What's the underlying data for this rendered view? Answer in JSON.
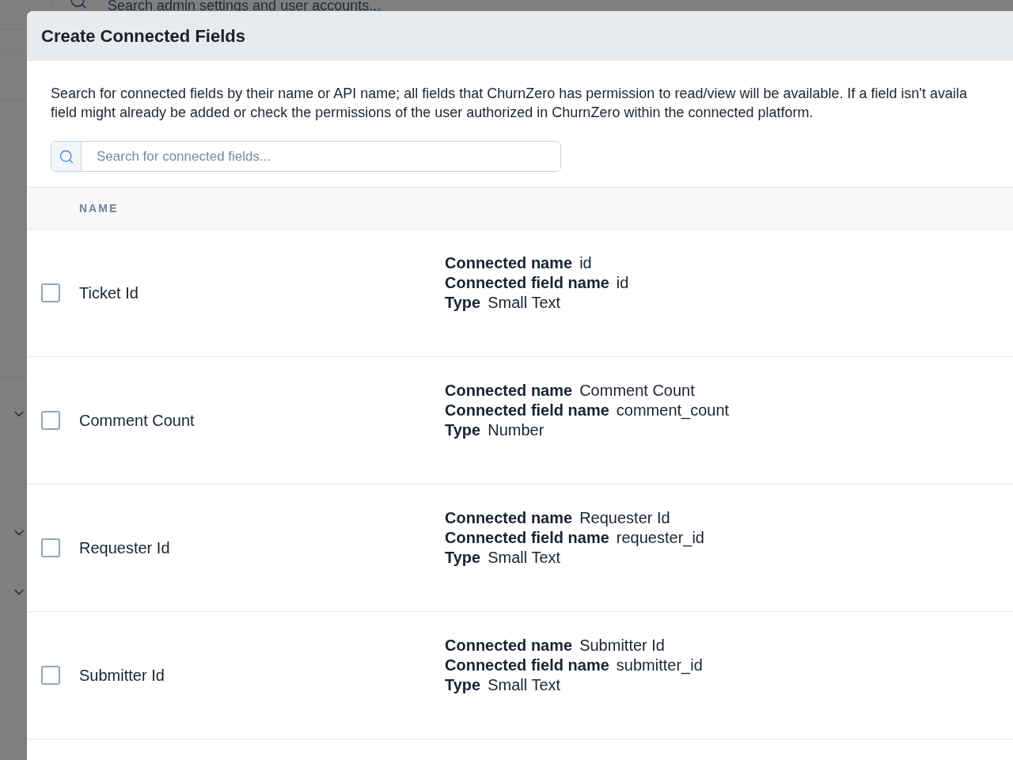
{
  "background": {
    "search": {
      "placeholder": "Search admin settings and user accounts..."
    }
  },
  "dialog": {
    "title": "Create Connected Fields",
    "description_lines": [
      "Search for connected fields by their name or API name; all fields that ChurnZero has permission to read/view will be available. If a field isn't availa",
      "field might already be added or check the permissions of the user authorized in ChurnZero within the connected platform."
    ],
    "search": {
      "placeholder": "Search for connected fields..."
    },
    "table": {
      "columns": [
        "NAME"
      ],
      "rows": [
        {
          "name": "Ticket Id",
          "checked": false,
          "details": [
            {
              "label": "Connected name",
              "value": "id"
            },
            {
              "label": "Connected field name",
              "value": "id"
            },
            {
              "label": "Type",
              "value": "Small Text"
            }
          ]
        },
        {
          "name": "Comment Count",
          "checked": false,
          "details": [
            {
              "label": "Connected name",
              "value": "Comment Count"
            },
            {
              "label": "Connected field name",
              "value": "comment_count"
            },
            {
              "label": "Type",
              "value": "Number"
            }
          ]
        },
        {
          "name": "Requester Id",
          "checked": false,
          "details": [
            {
              "label": "Connected name",
              "value": "Requester Id"
            },
            {
              "label": "Connected field name",
              "value": "requester_id"
            },
            {
              "label": "Type",
              "value": "Small Text"
            }
          ]
        },
        {
          "name": "Submitter Id",
          "checked": false,
          "details": [
            {
              "label": "Connected name",
              "value": "Submitter Id"
            },
            {
              "label": "Connected field name",
              "value": "submitter_id"
            },
            {
              "label": "Type",
              "value": "Small Text"
            }
          ]
        }
      ]
    }
  }
}
